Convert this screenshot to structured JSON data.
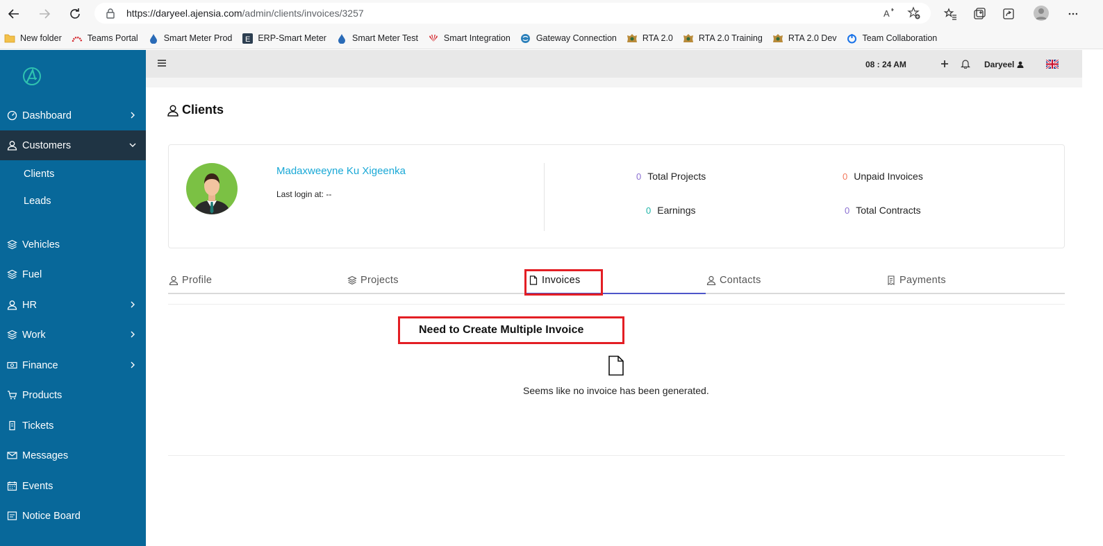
{
  "browser": {
    "url_prefix": "https://",
    "url_host": "daryeel.ajensia.com",
    "url_path": "/admin/clients/invoices/3257",
    "bookmarks": [
      {
        "label": "New folder",
        "icon": "folder-icon"
      },
      {
        "label": "Teams Portal",
        "icon": "teams-portal-icon"
      },
      {
        "label": "Smart Meter Prod",
        "icon": "drop-icon"
      },
      {
        "label": "ERP-Smart Meter",
        "icon": "erp-e-icon"
      },
      {
        "label": "Smart Meter Test",
        "icon": "drop-icon"
      },
      {
        "label": "Smart Integration",
        "icon": "huawei-icon"
      },
      {
        "label": "Gateway Connection",
        "icon": "gateway-icon"
      },
      {
        "label": "RTA 2.0",
        "icon": "rta-crest-icon"
      },
      {
        "label": "RTA 2.0 Training",
        "icon": "rta-crest-icon"
      },
      {
        "label": "RTA 2.0 Dev",
        "icon": "rta-crest-icon"
      },
      {
        "label": "Team Collaboration",
        "icon": "power-icon"
      }
    ]
  },
  "sidebar": {
    "items": [
      {
        "label": "Dashboard",
        "icon": "dashboard-icon"
      },
      {
        "label": "Customers",
        "icon": "user-icon"
      },
      {
        "label": "Clients"
      },
      {
        "label": "Leads"
      },
      {
        "label": "Vehicles",
        "icon": "layers-icon"
      },
      {
        "label": "Fuel",
        "icon": "layers-icon"
      },
      {
        "label": "HR",
        "icon": "user-icon"
      },
      {
        "label": "Work",
        "icon": "layers-icon"
      },
      {
        "label": "Finance",
        "icon": "money-icon"
      },
      {
        "label": "Products",
        "icon": "cart-icon"
      },
      {
        "label": "Tickets",
        "icon": "ticket-icon"
      },
      {
        "label": "Messages",
        "icon": "mail-icon"
      },
      {
        "label": "Events",
        "icon": "calendar-icon"
      },
      {
        "label": "Notice Board",
        "icon": "board-icon"
      }
    ]
  },
  "topbar": {
    "time": "08 : 24 AM",
    "user": "Daryeel"
  },
  "page": {
    "title": "Clients"
  },
  "client": {
    "name": "Madaxweeyne Ku Xigeenka",
    "last_login": "Last login at: --",
    "stats": {
      "total_projects": {
        "value": "0",
        "label": "Total Projects",
        "color": "#8a6fd1"
      },
      "unpaid_invoices": {
        "value": "0",
        "label": "Unpaid Invoices",
        "color": "#f2785c"
      },
      "earnings": {
        "value": "0",
        "label": "Earnings",
        "color": "#1fb5a8"
      },
      "total_contracts": {
        "value": "0",
        "label": "Total Contracts",
        "color": "#8a6fd1"
      }
    }
  },
  "tabs": [
    {
      "label": "Profile",
      "icon": "user-icon"
    },
    {
      "label": "Projects",
      "icon": "layers-icon"
    },
    {
      "label": "Invoices",
      "icon": "file-icon"
    },
    {
      "label": "Contacts",
      "icon": "user-icon"
    },
    {
      "label": "Payments",
      "icon": "receipt-icon"
    }
  ],
  "annotation": "Need to Create Multiple Invoice",
  "empty_state": "Seems like no invoice has been generated.",
  "colors": {
    "sidebar_bg": "#08689a",
    "sidebar_active": "#1f3444",
    "accent_link": "#19a8d6",
    "highlight_red": "#e31e24",
    "tab_active_line": "#4e55c9"
  }
}
